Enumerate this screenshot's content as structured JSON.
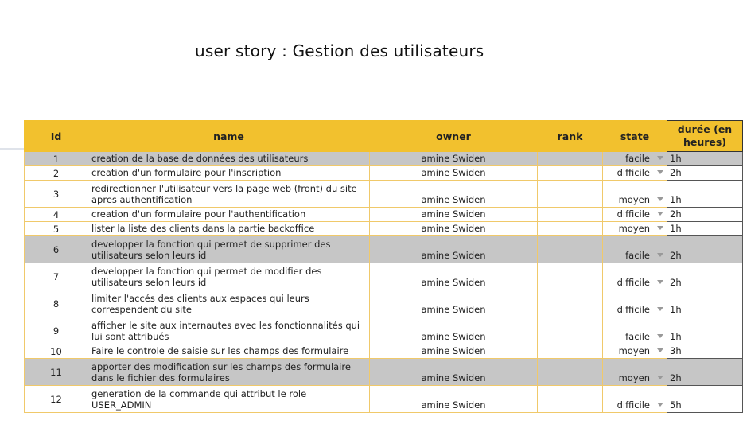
{
  "page": {
    "title": "user story : Gestion des utilisateurs"
  },
  "table": {
    "headers": {
      "id": "Id",
      "name": "name",
      "owner": "owner",
      "rank": "rank",
      "state": "state",
      "duree": "durée (en heures)"
    },
    "rows": [
      {
        "id": "1",
        "name": "creation de la base de données des utilisateurs",
        "owner": "amine Swiden",
        "rank": "",
        "state": "facile",
        "duree": "1h"
      },
      {
        "id": "2",
        "name": "creation d'un formulaire pour l'inscription",
        "owner": "amine Swiden",
        "rank": "",
        "state": "difficile",
        "duree": "2h"
      },
      {
        "id": "3",
        "name": "redirectionner l'utilisateur vers la page web (front) du site apres authentification",
        "owner": "amine Swiden",
        "rank": "",
        "state": "moyen",
        "duree": "1h"
      },
      {
        "id": "4",
        "name": "creation d'un formulaire pour l'authentification",
        "owner": "amine Swiden",
        "rank": "",
        "state": "difficile",
        "duree": "2h"
      },
      {
        "id": "5",
        "name": "lister la liste des clients dans la partie backoffice",
        "owner": "amine Swiden",
        "rank": "",
        "state": "moyen",
        "duree": "1h"
      },
      {
        "id": "6",
        "name": "developper la fonction qui permet de supprimer des utilisateurs selon leurs id",
        "owner": "amine Swiden",
        "rank": "",
        "state": "facile",
        "duree": "2h"
      },
      {
        "id": "7",
        "name": "developper la fonction qui permet de modifier des utilisateurs selon leurs id",
        "owner": "amine Swiden",
        "rank": "",
        "state": "difficile",
        "duree": "2h"
      },
      {
        "id": "8",
        "name": "limiter l'accés des clients aux espaces qui leurs correspendent du site",
        "owner": "amine Swiden",
        "rank": "",
        "state": "difficile",
        "duree": "1h"
      },
      {
        "id": "9",
        "name": "afficher le site aux internautes avec les fonctionnalités qui lui sont attribués",
        "owner": "amine Swiden",
        "rank": "",
        "state": "facile",
        "duree": "1h"
      },
      {
        "id": "10",
        "name": "Faire le controle de saisie sur les champs des formulaire",
        "owner": "amine Swiden",
        "rank": "",
        "state": "moyen",
        "duree": "3h"
      },
      {
        "id": "11",
        "name": "apporter des modification sur les champs des formulaire dans le fichier des formulaires",
        "owner": "amine Swiden",
        "rank": "",
        "state": "moyen",
        "duree": "2h"
      },
      {
        "id": "12",
        "name": "generation de la commande qui attribut le role USER_ADMIN",
        "owner": "amine Swiden",
        "rank": "",
        "state": "difficile",
        "duree": "5h"
      }
    ]
  },
  "icons": {
    "state_dropdown": "dropdown-arrow-icon"
  },
  "colors": {
    "header_bg": "#f2c12e",
    "highlight_row_bg": "#c6c6c6",
    "grid_line": "#f0c96a"
  }
}
